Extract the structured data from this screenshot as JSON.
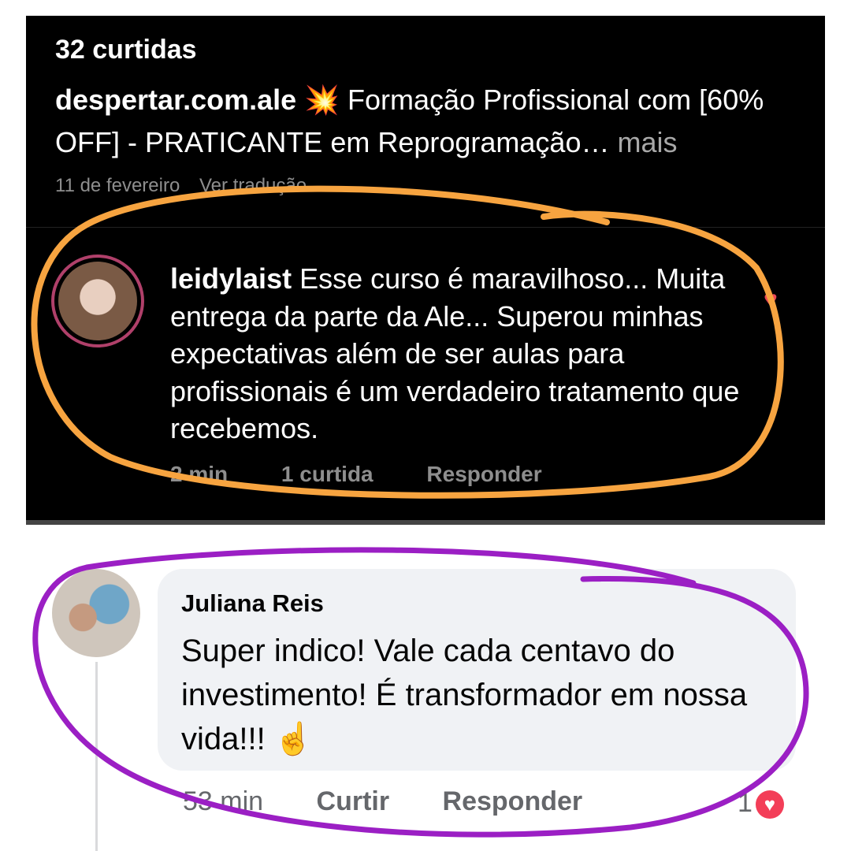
{
  "instagram": {
    "likes": "32 curtidas",
    "caption_user": "despertar.com.ale",
    "caption_emoji": "💥",
    "caption_text": " Formação Profissional com [60% OFF] - PRATICANTE em Reprogramação…",
    "caption_more": " mais",
    "post_date": "11 de fevereiro",
    "see_translation": "Ver tradução",
    "comment": {
      "user": "leidylaist",
      "text": " Esse curso é maravilhoso... Muita entrega da parte da Ale... Superou minhas expectativas além de ser aulas para profissionais é um verdadeiro tratamento que recebemos.",
      "time": "2 min",
      "likes": "1 curtida",
      "reply": "Responder",
      "heart_icon": "heart-icon"
    }
  },
  "facebook": {
    "comment": {
      "author": "Juliana Reis",
      "text": "Super indico! Vale cada centavo do investimento! É transformador em nossa vida!!! ☝️",
      "time": "53 min",
      "like": "Curtir",
      "reply": "Responder",
      "reaction_count": "1",
      "reaction_icon": "love-reaction-icon"
    }
  },
  "colors": {
    "ig_background": "#000000",
    "orange_annotation": "#f7a440",
    "purple_annotation": "#9b1fc4",
    "fb_bubble": "#f0f2f5",
    "love_reaction": "#f33e58"
  }
}
